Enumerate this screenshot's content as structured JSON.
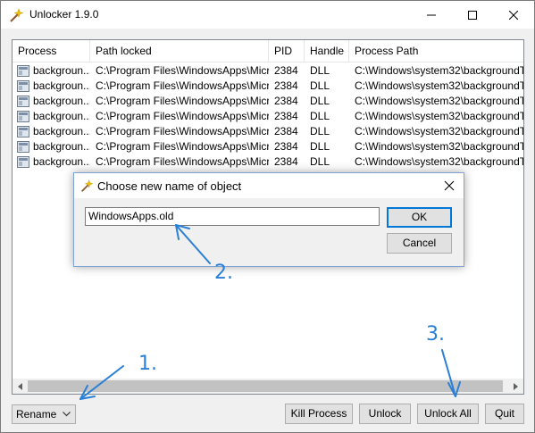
{
  "window": {
    "title": "Unlocker 1.9.0"
  },
  "columns": [
    "Process",
    "Path locked",
    "PID",
    "Handle",
    "Process Path"
  ],
  "rows": [
    {
      "process": "backgroun...",
      "path": "C:\\Program Files\\WindowsApps\\Micr...",
      "pid": "2384",
      "handle": "DLL",
      "process_path": "C:\\Windows\\system32\\backgroundT..."
    },
    {
      "process": "backgroun...",
      "path": "C:\\Program Files\\WindowsApps\\Micr...",
      "pid": "2384",
      "handle": "DLL",
      "process_path": "C:\\Windows\\system32\\backgroundT..."
    },
    {
      "process": "backgroun...",
      "path": "C:\\Program Files\\WindowsApps\\Micr...",
      "pid": "2384",
      "handle": "DLL",
      "process_path": "C:\\Windows\\system32\\backgroundT..."
    },
    {
      "process": "backgroun...",
      "path": "C:\\Program Files\\WindowsApps\\Micr...",
      "pid": "2384",
      "handle": "DLL",
      "process_path": "C:\\Windows\\system32\\backgroundT..."
    },
    {
      "process": "backgroun...",
      "path": "C:\\Program Files\\WindowsApps\\Micr...",
      "pid": "2384",
      "handle": "DLL",
      "process_path": "C:\\Windows\\system32\\backgroundT..."
    },
    {
      "process": "backgroun...",
      "path": "C:\\Program Files\\WindowsApps\\Micr...",
      "pid": "2384",
      "handle": "DLL",
      "process_path": "C:\\Windows\\system32\\backgroundT..."
    },
    {
      "process": "backgroun...",
      "path": "C:\\Program Files\\WindowsApps\\Micr...",
      "pid": "2384",
      "handle": "DLL",
      "process_path": "C:\\Windows\\system32\\backgroundT..."
    }
  ],
  "action_select": {
    "value": "Rename"
  },
  "buttons": {
    "kill_process": "Kill Process",
    "unlock": "Unlock",
    "unlock_all": "Unlock All",
    "quit": "Quit"
  },
  "dialog": {
    "title": "Choose new name of object",
    "input_value": "WindowsApps.old",
    "ok": "OK",
    "cancel": "Cancel"
  },
  "annotations": {
    "step1": "1.",
    "step2": "2.",
    "step3": "3."
  },
  "colors": {
    "annotation": "#2a7fd6",
    "focus_border": "#0078d7"
  },
  "icons": {
    "app": "wand-icon",
    "process": "process-icon"
  }
}
